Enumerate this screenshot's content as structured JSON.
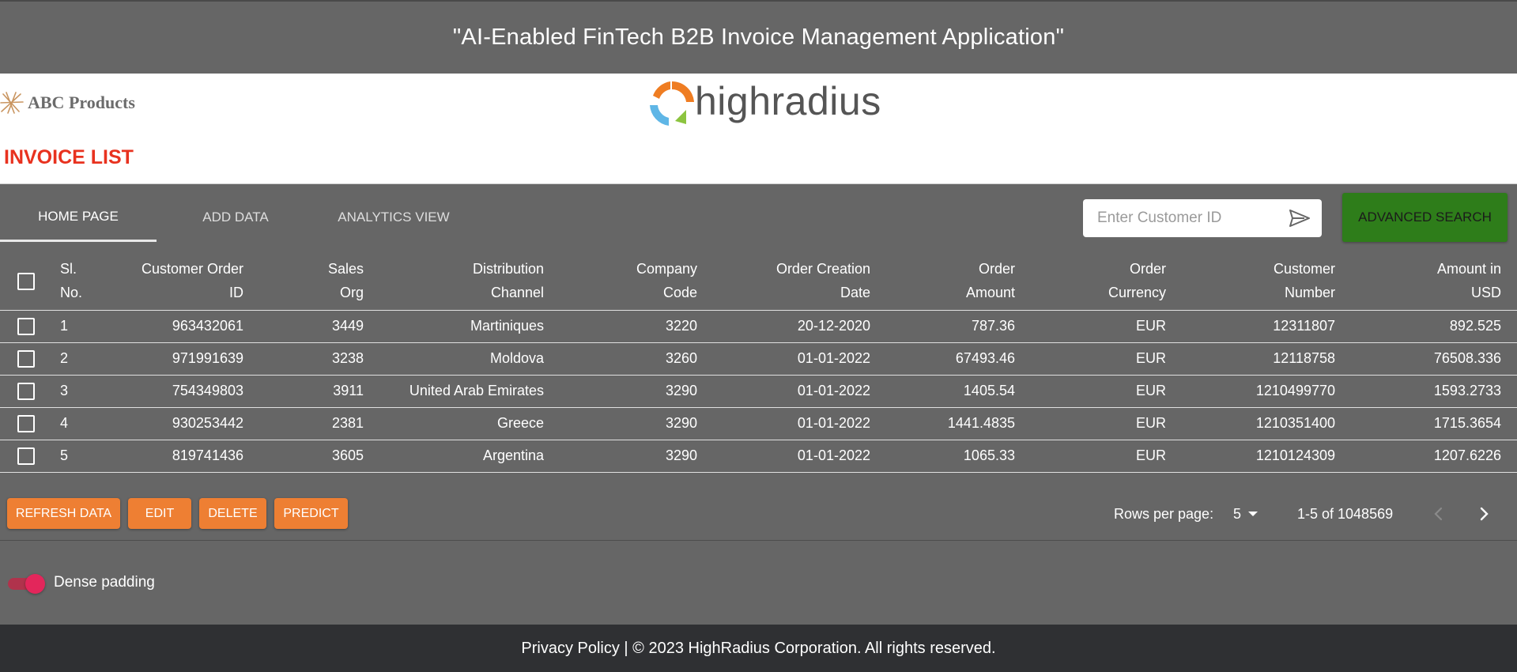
{
  "header": {
    "title": "\"AI-Enabled FinTech B2B Invoice Management Application\""
  },
  "brand": {
    "company_name": "ABC Products",
    "partner_logo_text": "highradius"
  },
  "page": {
    "title": "INVOICE LIST"
  },
  "tabs": [
    {
      "label": "HOME PAGE",
      "active": true
    },
    {
      "label": "ADD DATA",
      "active": false
    },
    {
      "label": "ANALYTICS VIEW",
      "active": false
    }
  ],
  "search": {
    "placeholder": "Enter Customer ID",
    "value": "",
    "icon": "send-icon"
  },
  "advanced_search": {
    "label": "ADVANCED SEARCH",
    "color": "#2e7d1a"
  },
  "table": {
    "columns": [
      {
        "line1": "Sl.",
        "line2": "No."
      },
      {
        "line1": "Customer Order",
        "line2": "ID"
      },
      {
        "line1": "Sales",
        "line2": "Org"
      },
      {
        "line1": "Distribution",
        "line2": "Channel"
      },
      {
        "line1": "Company",
        "line2": "Code"
      },
      {
        "line1": "Order Creation",
        "line2": "Date"
      },
      {
        "line1": "Order",
        "line2": "Amount"
      },
      {
        "line1": "Order",
        "line2": "Currency"
      },
      {
        "line1": "Customer",
        "line2": "Number"
      },
      {
        "line1": "Amount in",
        "line2": "USD"
      }
    ],
    "rows": [
      [
        "1",
        "963432061",
        "3449",
        "Martiniques",
        "3220",
        "20-12-2020",
        "787.36",
        "EUR",
        "12311807",
        "892.525"
      ],
      [
        "2",
        "971991639",
        "3238",
        "Moldova",
        "3260",
        "01-01-2022",
        "67493.46",
        "EUR",
        "12118758",
        "76508.336"
      ],
      [
        "3",
        "754349803",
        "3911",
        "United Arab Emirates",
        "3290",
        "01-01-2022",
        "1405.54",
        "EUR",
        "1210499770",
        "1593.2733"
      ],
      [
        "4",
        "930253442",
        "2381",
        "Greece",
        "3290",
        "01-01-2022",
        "1441.4835",
        "EUR",
        "1210351400",
        "1715.3654"
      ],
      [
        "5",
        "819741436",
        "3605",
        "Argentina",
        "3290",
        "01-01-2022",
        "1065.33",
        "EUR",
        "1210124309",
        "1207.6226"
      ]
    ]
  },
  "actions": {
    "refresh": "REFRESH DATA",
    "edit": "EDIT",
    "delete": "DELETE",
    "predict": "PREDICT",
    "color": "#ee7f33"
  },
  "pagination": {
    "rows_per_page_label": "Rows per page:",
    "rows_per_page": "5",
    "range": "1-5 of 1048569"
  },
  "dense": {
    "label": "Dense padding",
    "on": true,
    "color": "#e3265b"
  },
  "footer": {
    "text": "Privacy Policy | © 2023 HighRadius Corporation. All rights reserved."
  },
  "colors": {
    "accent_red": "#e8321f",
    "surface": "#666666",
    "footer_bg": "#2f3033"
  }
}
